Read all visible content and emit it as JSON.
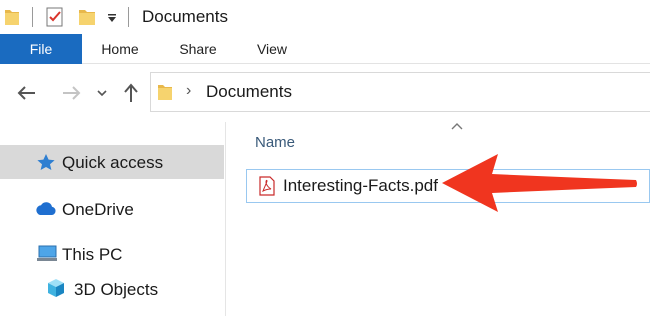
{
  "window": {
    "title": "Documents",
    "quick_access_toolbar": [
      "folder-icon",
      "properties-check-icon",
      "new-folder-icon",
      "customize-dropdown-icon"
    ]
  },
  "ribbon": {
    "tabs": [
      {
        "label": "File",
        "active": true
      },
      {
        "label": "Home"
      },
      {
        "label": "Share"
      },
      {
        "label": "View"
      }
    ]
  },
  "address_bar": {
    "path": [
      "Documents"
    ]
  },
  "nav_pane": {
    "items": [
      {
        "label": "Quick access",
        "icon": "star-icon",
        "selected": true
      },
      {
        "label": "OneDrive",
        "icon": "cloud-icon"
      },
      {
        "label": "This PC",
        "icon": "computer-icon"
      },
      {
        "label": "3D Objects",
        "icon": "cube-icon"
      }
    ]
  },
  "content": {
    "column_header": "Name",
    "files": [
      {
        "name": "Interesting-Facts.pdf",
        "icon": "pdf-icon"
      }
    ]
  },
  "colors": {
    "file_tab": "#1a6bc0",
    "selection_border": "#99c8f0",
    "arrow": "#f0351f",
    "nav_selected": "#d9d9d9"
  }
}
